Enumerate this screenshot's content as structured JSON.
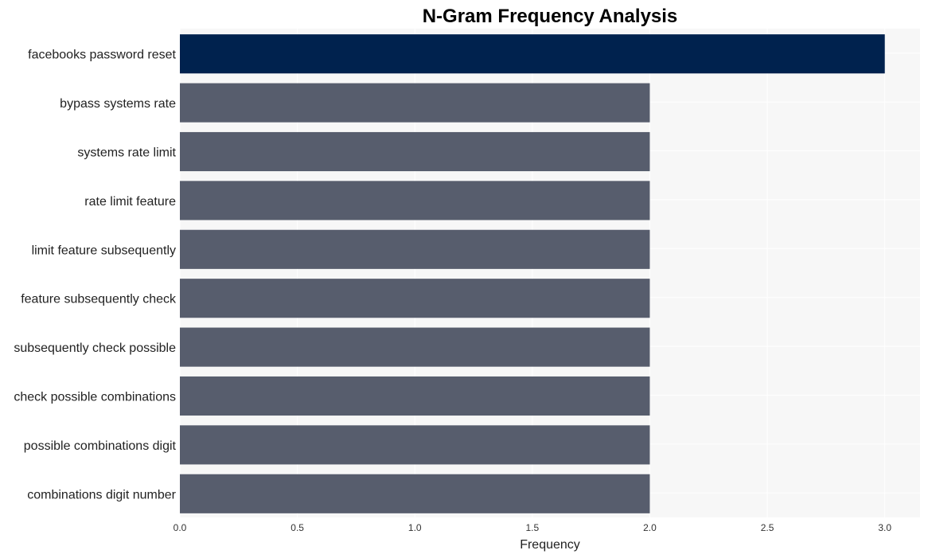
{
  "chart_data": {
    "type": "bar",
    "orientation": "horizontal",
    "title": "N-Gram Frequency Analysis",
    "xlabel": "Frequency",
    "ylabel": "",
    "xlim": [
      0,
      3.15
    ],
    "xticks": [
      0.0,
      0.5,
      1.0,
      1.5,
      2.0,
      2.5,
      3.0
    ],
    "xtick_labels": [
      "0.0",
      "0.5",
      "1.0",
      "1.5",
      "2.0",
      "2.5",
      "3.0"
    ],
    "grid": true,
    "categories": [
      "facebooks password reset",
      "bypass systems rate",
      "systems rate limit",
      "rate limit feature",
      "limit feature subsequently",
      "feature subsequently check",
      "subsequently check possible",
      "check possible combinations",
      "possible combinations digit",
      "combinations digit number"
    ],
    "values": [
      3,
      2,
      2,
      2,
      2,
      2,
      2,
      2,
      2,
      2
    ],
    "colors": {
      "highlight": "#00224e",
      "default": "#575d6d",
      "plot_background": "#f7f7f7",
      "grid": "#ffffff"
    }
  }
}
